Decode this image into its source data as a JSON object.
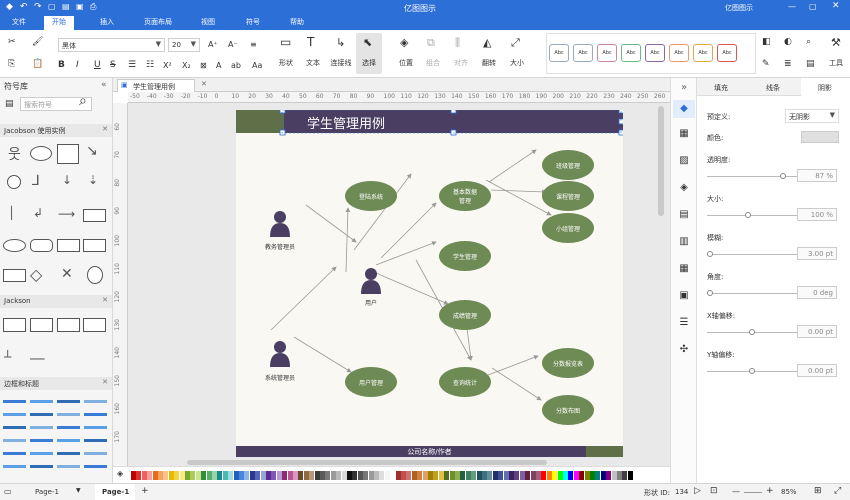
{
  "app": {
    "title": "亿图图示",
    "user": "亿图图示"
  },
  "menu": [
    "文件",
    "开始",
    "插入",
    "页面布局",
    "视图",
    "符号",
    "帮助"
  ],
  "ribbon": {
    "font_name": "黑体",
    "font_size": "20",
    "labels": {
      "shape": "形状",
      "text": "文本",
      "connector": "连接线",
      "select": "选择",
      "position": "位置",
      "group": "组合",
      "align": "对齐",
      "flip": "翻转",
      "size": "大小",
      "tools": "工具"
    },
    "style_swatches": [
      "Abc",
      "Abc",
      "Abc",
      "Abc",
      "Abc",
      "Abc",
      "Abc",
      "Abc"
    ]
  },
  "left_panel": {
    "title": "符号库",
    "search_placeholder": "搜索符号",
    "sections": [
      "Jacobson 使用实例",
      "Jackson",
      "边框和标题"
    ]
  },
  "tab": {
    "name": "学生管理用例"
  },
  "ruler_h": [
    "-50",
    "-40",
    "-30",
    "-20",
    "-10",
    "0",
    "10",
    "20",
    "30",
    "40",
    "50",
    "60",
    "70",
    "80",
    "90",
    "100",
    "110",
    "120",
    "130",
    "140",
    "150",
    "160",
    "170",
    "180",
    "190",
    "200",
    "210",
    "220",
    "230",
    "240",
    "250",
    "260"
  ],
  "ruler_v": [
    "60",
    "70",
    "80",
    "90",
    "100",
    "110",
    "120",
    "130",
    "140",
    "150",
    "160",
    "170"
  ],
  "diagram": {
    "title": "学生管理用例",
    "footer": "公司名称/作者",
    "actors": {
      "teacher": "教务管理员",
      "user": "用户",
      "admin": "系统管理员"
    },
    "usecases": {
      "login": "登陆系统",
      "basic": [
        "基本数据",
        "管理"
      ],
      "student": "学生管理",
      "score": "成绩管理",
      "usermgmt": "用户管理",
      "query": "查询统计",
      "class": "班级管理",
      "course": "课程管理",
      "group": "小组管理",
      "report": "分数报览表",
      "dist": "分数布图"
    },
    "colors": {
      "header": "#4a3f63",
      "node": "#6e8a55",
      "actor": "#4a3f63",
      "line": "#999999"
    }
  },
  "right_panel": {
    "tabs": [
      "填充",
      "线条",
      "阴影"
    ],
    "preset_label": "预定义:",
    "preset_value": "无阴影",
    "color_label": "颜色:",
    "fields": [
      {
        "label": "透明度:",
        "value": "87 %",
        "pct": 0.87
      },
      {
        "label": "大小:",
        "value": "100 %",
        "pct": 0.45
      },
      {
        "label": "模糊:",
        "value": "3.00 pt",
        "pct": 0.0
      },
      {
        "label": "角度:",
        "value": "0 deg",
        "pct": 0.0
      },
      {
        "label": "X轴偏移:",
        "value": "0.00 pt",
        "pct": 0.5
      },
      {
        "label": "Y轴偏移:",
        "value": "0.00 pt",
        "pct": 0.5
      }
    ]
  },
  "status": {
    "page_tab_1": "Page-1",
    "page_tab_2": "Page-1",
    "shape_id_label": "形状 ID:",
    "shape_id": "134",
    "zoom": "85%"
  }
}
